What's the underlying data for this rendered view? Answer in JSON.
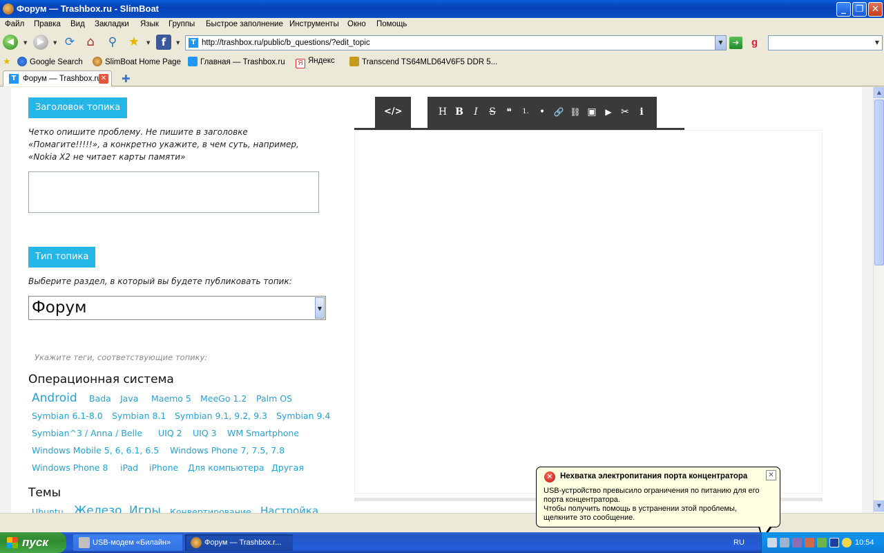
{
  "window": {
    "title": "Форум — Trashbox.ru - SlimBoat"
  },
  "menu": [
    "Файл",
    "Правка",
    "Вид",
    "Закладки",
    "Язык",
    "Группы",
    "Быстрое заполнение",
    "Инструменты",
    "Окно",
    "Помощь"
  ],
  "address": {
    "url": "http://trashbox.ru/public/b_questions/?edit_topic"
  },
  "bookmarks": [
    "Google Search",
    "SlimBoat Home Page",
    "Главная — Trashbox.ru",
    "Яндекс",
    "Transcend TS64MLD64V6F5 DDR 5..."
  ],
  "tab": {
    "label": "Форум — Trashbox.ru"
  },
  "form": {
    "title_heading": "Заголовок топика",
    "title_hint": "Четко опишите проблему. Не пишите в заголовке «Помагите!!!!!», а конкретно укажите, в чем суть, например, «Nokia X2 не читает карты памяти»",
    "title_value": "",
    "type_heading": "Тип топика",
    "type_hint": "Выберите раздел, в который вы будете публиковать топик:",
    "type_selected": "Форум",
    "tags_hint": "Укажите теги, соответствующие топику:"
  },
  "tag_sections": [
    {
      "title": "Операционная система",
      "tags": [
        "Android",
        "Bada",
        "Java",
        "Maemo 5",
        "MeeGo 1.2",
        "Palm OS",
        "Symbian 6.1-8.0",
        "Symbian 8.1",
        "Symbian 9.1, 9.2, 9.3",
        "Symbian 9.4",
        "Symbian^3 / Anna / Belle",
        "UIQ 2",
        "UIQ 3",
        "WM Smartphone",
        "Windows Mobile 5, 6, 6.1, 6.5",
        "Windows Phone 7, 7.5, 7.8",
        "Windows Phone 8",
        "iPad",
        "iPhone",
        "Для компьютера",
        "Другая"
      ]
    },
    {
      "title": "Темы",
      "tags": [
        "Ubuntu",
        "Железо",
        "Игры",
        "Конвертирование",
        "Настройка"
      ]
    }
  ],
  "editor": {
    "source_label": "</>",
    "toolbar": [
      "H",
      "B",
      "I",
      "S",
      "❝",
      "1.",
      "•",
      "🔗",
      "⛓",
      "▣",
      "▶",
      "✂",
      "i"
    ]
  },
  "notification": {
    "title": "Нехватка электропитания порта концентратора",
    "body_line1": "USB-устройство превысило ограничения по питанию для его порта концентратора.",
    "body_line2": "Чтобы получить помощь в устранении этой проблемы, щелкните это сообщение."
  },
  "taskbar": {
    "start_label": "пуск",
    "tasks": [
      "USB-модем «Билайн»",
      "Форум — Trashbox.r..."
    ],
    "lang": "RU",
    "clock": "10:54"
  },
  "colors": {
    "accent": "#25b6e8",
    "tag_link": "#23a3d6",
    "editor_toolbar": "#3a3a3a"
  }
}
